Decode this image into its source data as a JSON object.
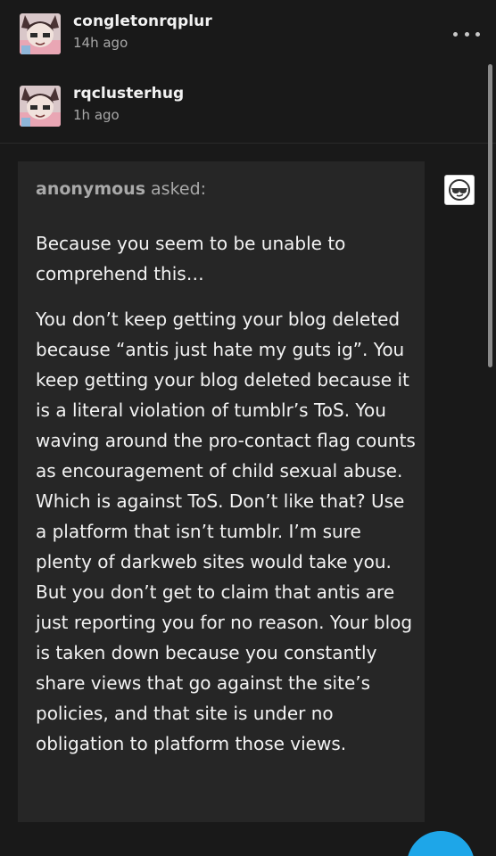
{
  "posts": [
    {
      "username": "congletonrqplur",
      "timestamp": "14h ago",
      "avatar_icon": "anime-avatar-icon"
    },
    {
      "username": "rqclusterhug",
      "timestamp": "1h ago",
      "avatar_icon": "anime-avatar-icon"
    }
  ],
  "menu": {
    "more_icon": "more-horizontal-icon"
  },
  "ask": {
    "asker": "anonymous",
    "asked_label": " asked:",
    "badge_icon": "anonymous-sunglasses-icon",
    "paragraphs": [
      "Because you seem to be unable to comprehend this…",
      "You don’t keep getting your blog deleted because “antis just hate my guts ig”. You keep getting your blog deleted because it is a literal violation of tumblr’s ToS. You waving around the pro-contact flag counts as encouragement of child sexual abuse. Which is against ToS. Don’t like that? Use a platform that isn’t tumblr. I’m sure plenty of darkweb sites would take you. But you don’t get to claim that antis are just reporting you for no reason. Your blog is taken down because you constantly share views that go against the site’s policies, and that site is under no obligation to platform those views."
    ]
  },
  "compose": {
    "icon": "compose-icon"
  },
  "colors": {
    "background": "#191919",
    "card": "#262626",
    "accent": "#1ea6e8",
    "muted_text": "#a8a8a8"
  }
}
